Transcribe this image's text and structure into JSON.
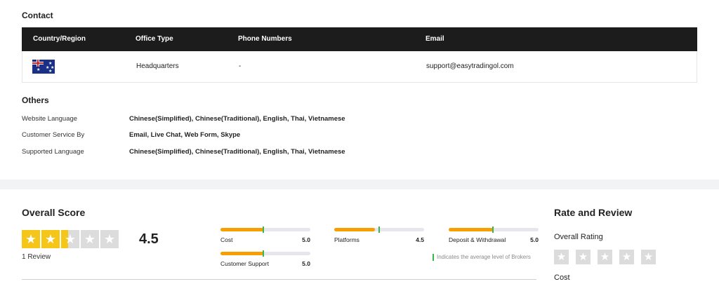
{
  "contact": {
    "title": "Contact",
    "headers": [
      "Country/Region",
      "Office Type",
      "Phone Numbers",
      "Email"
    ],
    "row": {
      "flag": "australia-flag-icon",
      "office_type": "Headquarters",
      "phone": "-",
      "email": "support@easytradingol.com"
    }
  },
  "others": {
    "title": "Others",
    "rows": [
      {
        "label": "Website Language",
        "value": "Chinese(Simplified), Chinese(Traditional), English, Thai, Vietnamese"
      },
      {
        "label": "Customer Service By",
        "value": "Email, Live Chat, Web Form, Skype"
      },
      {
        "label": "Supported Language",
        "value": "Chinese(Simplified), Chinese(Traditional), English, Thai, Vietnamese"
      }
    ]
  },
  "overall": {
    "title": "Overall Score",
    "score": "4.5",
    "star_fill": [
      1,
      1,
      0.4,
      0,
      0
    ],
    "reviews": "1 Review",
    "metrics": [
      {
        "label": "Cost",
        "value": "5.0",
        "fill": 0.48,
        "avg": 0.48
      },
      {
        "label": "Platforms",
        "value": "4.5",
        "fill": 0.45,
        "avg": 0.5
      },
      {
        "label": "Deposit & Withdrawal",
        "value": "5.0",
        "fill": 0.49,
        "avg": 0.49
      },
      {
        "label": "Customer Support",
        "value": "5.0",
        "fill": 0.48,
        "avg": 0.48
      }
    ],
    "avg_note": "Indicates the average level of Brokers"
  },
  "rate_review": {
    "title": "Rate and Review",
    "overall_rating_label": "Overall Rating",
    "cost_label": "Cost"
  },
  "colors": {
    "accent_star": "#f5c518",
    "bar_fill": "#f5a000",
    "avg_marker": "#3bb54a",
    "table_header": "#1c1c1c"
  }
}
